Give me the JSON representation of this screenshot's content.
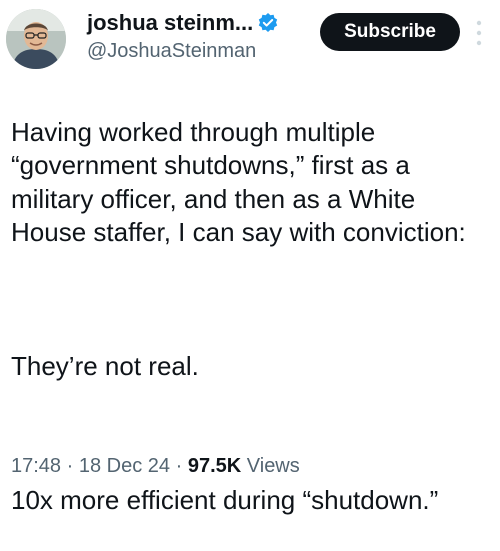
{
  "colors": {
    "text_primary": "#0f1419",
    "text_secondary": "#536471",
    "verified_blue": "#1d9bf0",
    "subscribe_bg": "#0f1419",
    "subscribe_text": "#ffffff"
  },
  "author": {
    "display_name": "joshua steinm...",
    "handle": "@JoshuaSteinman",
    "verified_icon": "verified-badge-icon",
    "avatar_icon": "profile-avatar"
  },
  "actions": {
    "subscribe_label": "Subscribe",
    "more_icon": "more-vertical-icon"
  },
  "tweet": {
    "paragraphs": [
      "Having worked through multiple “government shutdowns,” first as a military officer, and then as a White House staffer, I can say with conviction:",
      "They’re not real.",
      "10x more efficient during “shutdown.”"
    ]
  },
  "meta": {
    "time": "17:48",
    "separator": "·",
    "date": "18 Dec 24",
    "views_count": "97.5K",
    "views_label": "Views"
  }
}
